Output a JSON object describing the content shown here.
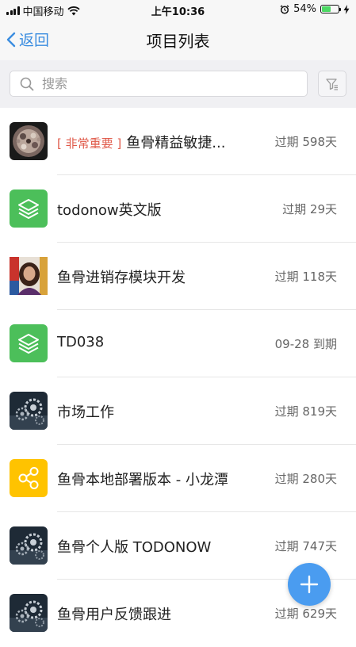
{
  "status_bar": {
    "carrier": "中国移动",
    "time": "上午10:36",
    "battery_percent": "54%",
    "battery_level": 0.54
  },
  "nav": {
    "back_label": "返回",
    "title": "项目列表"
  },
  "search": {
    "placeholder": "搜索"
  },
  "colors": {
    "accent": "#3b8de0",
    "important_tag": "#e05a4a",
    "green_icon": "#4cbf5a",
    "yellow_icon": "#ffc300",
    "fab": "#4a9cf0"
  },
  "projects": [
    {
      "tag": "[ 非常重要 ]",
      "title": "鱼骨精益敏捷...",
      "status": "过期 598天",
      "icon": "mosaic-photo"
    },
    {
      "tag": "",
      "title": "todonow英文版",
      "status": "过期 29天",
      "icon": "layers-icon"
    },
    {
      "tag": "",
      "title": "鱼骨进销存模块开发",
      "status": "过期 118天",
      "icon": "portrait-photo"
    },
    {
      "tag": "",
      "title": "TD038",
      "status": "09-28 到期",
      "icon": "layers-icon"
    },
    {
      "tag": "",
      "title": "市场工作",
      "status": "过期 819天",
      "icon": "gears-photo"
    },
    {
      "tag": "",
      "title": "鱼骨本地部署版本 - 小龙潭",
      "status": "过期 280天",
      "icon": "share-nodes-icon"
    },
    {
      "tag": "",
      "title": "鱼骨个人版 TODONOW",
      "status": "过期 747天",
      "icon": "gears-photo"
    },
    {
      "tag": "",
      "title": "鱼骨用户反馈跟进",
      "status": "过期 629天",
      "icon": "gears-photo"
    }
  ]
}
